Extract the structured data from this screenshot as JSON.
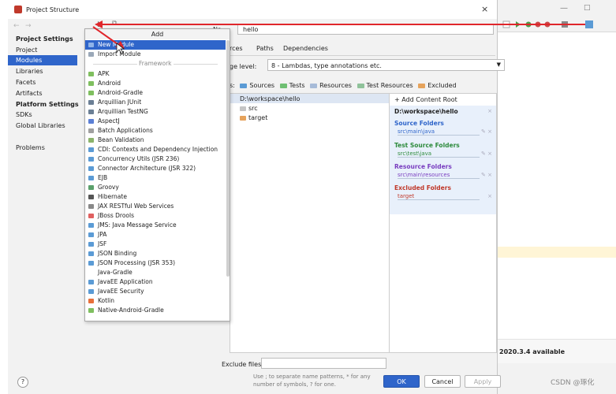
{
  "window": {
    "title": "Project Structure",
    "close": "×"
  },
  "ide": {
    "status": "2020.3.4 available",
    "minimize": "—",
    "maximize": "□",
    "watermark": "CSDN @琢化"
  },
  "nav": {
    "back": "←",
    "forward": "→",
    "project_settings": "Project Settings",
    "items_ps": [
      "Project",
      "Modules",
      "Libraries",
      "Facets",
      "Artifacts"
    ],
    "platform_settings": "Platform Settings",
    "items_plat": [
      "SDKs",
      "Global Libraries"
    ],
    "problems": "Problems",
    "selected": "Modules"
  },
  "toolbar": {
    "add": "+",
    "copy": "⧉"
  },
  "module": {
    "name_label": "Na",
    "name_value": "hello",
    "tabs": [
      "rces",
      "Paths",
      "Dependencies"
    ],
    "lang_label": "ge level:",
    "lang_value": "8 - Lambdas, type annotations etc.",
    "mark_label": "s:",
    "mark_sources": "Sources",
    "mark_tests": "Tests",
    "mark_resources": "Resources",
    "mark_test_resources": "Test Resources",
    "mark_excluded": "Excluded"
  },
  "tree": {
    "root": "D:\\workspace\\hello",
    "children": [
      "src",
      "target"
    ]
  },
  "content_root": {
    "add": "+ Add Content Root",
    "path": "D:\\workspace\\hello",
    "source_h": "Source Folders",
    "source_p": "src\\main\\java",
    "test_h": "Test Source Folders",
    "test_p": "src\\test\\java",
    "res_h": "Resource Folders",
    "res_p": "src\\main\\resources",
    "exc_h": "Excluded Folders",
    "exc_p": "target"
  },
  "exclude": {
    "label": "Exclude files:",
    "hint1": "Use ; to separate name patterns, * for any",
    "hint2": "number of symbols, ? for one."
  },
  "buttons": {
    "help": "?",
    "ok": "OK",
    "cancel": "Cancel",
    "apply": "Apply"
  },
  "popup": {
    "title": "Add",
    "top_items": [
      "New Module",
      "Import Module"
    ],
    "separator": "Framework",
    "frameworks": [
      "APK",
      "Android",
      "Android-Gradle",
      "Arquillian JUnit",
      "Arquillian TestNG",
      "AspectJ",
      "Batch Applications",
      "Bean Validation",
      "CDI: Contexts and Dependency Injection",
      "Concurrency Utils (JSR 236)",
      "Connector Architecture (JSR 322)",
      "EJB",
      "Groovy",
      "Hibernate",
      "JAX RESTful Web Services",
      "JBoss Drools",
      "JMS: Java Message Service",
      "JPA",
      "JSF",
      "JSON Binding",
      "JSON Processing (JSR 353)",
      "Java-Gradle",
      "JavaEE Application",
      "JavaEE Security",
      "Kotlin",
      "Native-Android-Gradle"
    ]
  },
  "colors": {
    "accent": "#2f65ca",
    "annotation": "#e0262b"
  }
}
